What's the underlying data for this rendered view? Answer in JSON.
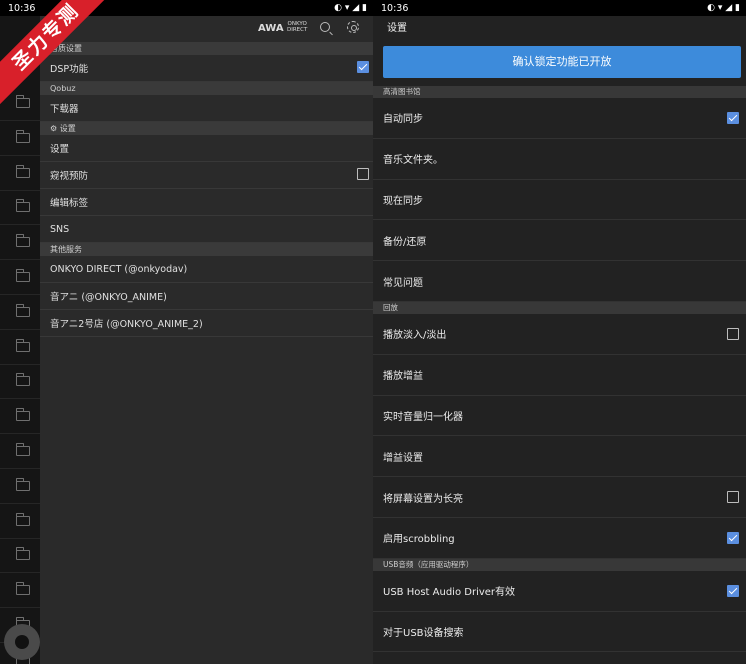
{
  "left": {
    "status_time": "10:36",
    "status_icons": "◐ ▾ ◢ ▮",
    "ribbon": "圣力专测",
    "brand_awa": "AWA",
    "brand_onkyo_line1": "ONKYO",
    "brand_onkyo_line2": "DIRECT",
    "sections": [
      {
        "header": "音质设置",
        "items": [
          {
            "label": "DSP功能",
            "checkbox": true,
            "checked": true
          }
        ]
      },
      {
        "header": "Qobuz",
        "items": [
          {
            "label": "下载器"
          }
        ]
      },
      {
        "header": "⚙ 设置",
        "items": [
          {
            "label": "设置"
          },
          {
            "label": "窥视预防",
            "checkbox": true,
            "checked": false
          },
          {
            "label": "编辑标签"
          },
          {
            "label": "SNS"
          }
        ]
      },
      {
        "header": "其他服务",
        "items": [
          {
            "label": "ONKYO DIRECT (@onkyodav)"
          },
          {
            "label": "音アニ (@ONKYO_ANIME)"
          },
          {
            "label": "音アニ2号店 (@ONKYO_ANIME_2)"
          }
        ]
      }
    ]
  },
  "right": {
    "status_time": "10:36",
    "status_icons": "◐ ▾ ◢ ▮",
    "title": "设置",
    "confirm_button": "确认锁定功能已开放",
    "sections": [
      {
        "header": "高清图书馆",
        "items": [
          {
            "label": "自动同步",
            "checkbox": true,
            "checked": true
          },
          {
            "label": "音乐文件夹。"
          },
          {
            "label": "现在同步"
          },
          {
            "label": "备份/还原"
          },
          {
            "label": "常见问题"
          }
        ]
      },
      {
        "header": "回放",
        "items": [
          {
            "label": "播放淡入/淡出",
            "checkbox": true,
            "checked": false
          },
          {
            "label": "播放增益"
          },
          {
            "label": "实时音量归一化器"
          },
          {
            "label": "增益设置"
          },
          {
            "label": "将屏幕设置为长亮",
            "checkbox": true,
            "checked": false
          },
          {
            "label": "启用scrobbling",
            "checkbox": true,
            "checked": true
          }
        ]
      },
      {
        "header": "USB音频（应用驱动程序）",
        "items": [
          {
            "label": "USB Host Audio Driver有效",
            "checkbox": true,
            "checked": true
          },
          {
            "label": "对于USB设备搜索"
          }
        ]
      }
    ]
  },
  "colors": {
    "accent": "#3d8bdb",
    "ribbon": "#d8202a"
  }
}
